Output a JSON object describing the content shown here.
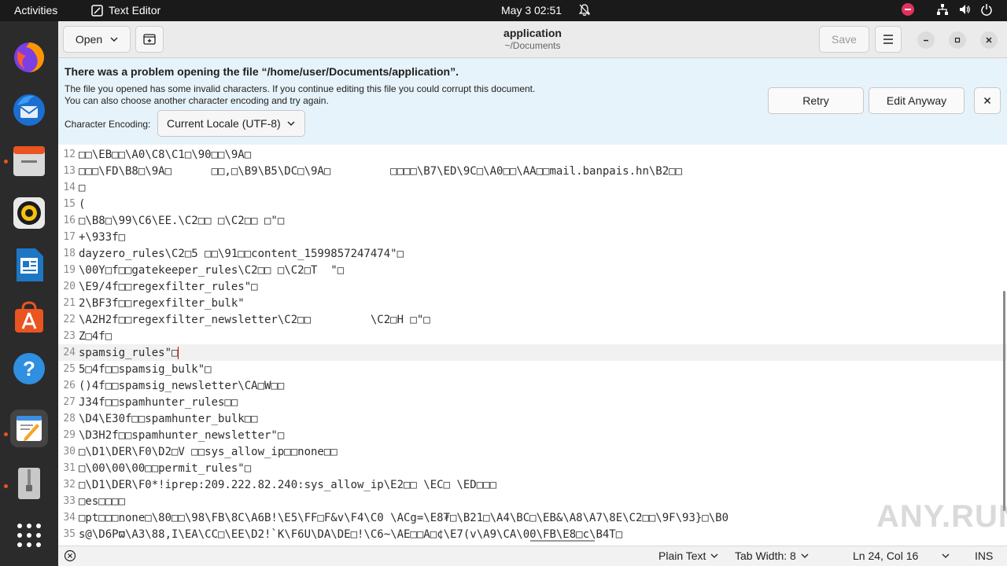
{
  "topbar": {
    "activities": "Activities",
    "app_name": "Text Editor",
    "clock": "May 3  02:51"
  },
  "window": {
    "title": "application",
    "subtitle": "~/Documents",
    "open_label": "Open",
    "save_label": "Save"
  },
  "infobar": {
    "title": "There was a problem opening the file “/home/user/Documents/application”.",
    "line1": "The file you opened has some invalid characters. If you continue editing this file you could corrupt this document.",
    "line2": "You can also choose another character encoding and try again.",
    "encoding_label": "Character Encoding:",
    "encoding_value": "Current Locale (UTF-8)",
    "retry_label": "Retry",
    "edit_anyway_label": "Edit Anyway"
  },
  "editor": {
    "lines": [
      {
        "n": "12",
        "t": "□□\\EB□□\\A0\\C8\\C1□\\90□□\\9A□"
      },
      {
        "n": "13",
        "t": "□□□\\FD\\B8□\\9A□      □□,□\\B9\\B5\\DC□\\9A□         □□□□\\B7\\ED\\9C□\\A0□□\\AA□□mail.banpais.hn\\B2□□"
      },
      {
        "n": "14",
        "t": "□"
      },
      {
        "n": "15",
        "t": "("
      },
      {
        "n": "16",
        "t": "□\\B8□\\99\\C6\\EE.\\C2□□ □\\C2□□ □\"□"
      },
      {
        "n": "17",
        "t": "+\\933f□"
      },
      {
        "n": "18",
        "t": "dayzero_rules\\C2□5 □□\\91□□content_1599857247474\"□"
      },
      {
        "n": "19",
        "t": "\\00Y□f□□gatekeeper_rules\\C2□□ □\\C2□T  \"□"
      },
      {
        "n": "20",
        "t": "\\E9/4f□□regexfilter_rules\"□"
      },
      {
        "n": "21",
        "t": "2\\BF3f□□regexfilter_bulk\""
      },
      {
        "n": "22",
        "t": "\\A2H2f□□regexfilter_newsletter\\C2□□         \\C2□H □\"□"
      },
      {
        "n": "23",
        "t": "Z□4f□"
      },
      {
        "n": "24",
        "t": "spamsig_rules\"□",
        "current": true
      },
      {
        "n": "25",
        "t": "5□4f□□spamsig_bulk\"□"
      },
      {
        "n": "26",
        "t": "()4f□□spamsig_newsletter\\CA□W□□"
      },
      {
        "n": "27",
        "t": "J34f□□spamhunter_rules□□"
      },
      {
        "n": "28",
        "t": "\\D4\\E30f□□spamhunter_bulk□□"
      },
      {
        "n": "29",
        "t": "\\D3H2f□□spamhunter_newsletter\"□"
      },
      {
        "n": "30",
        "t": "□\\D1\\DER\\F0\\D2□V □□sys_allow_ip□□none□□"
      },
      {
        "n": "31",
        "t": "□\\00\\00\\00□□permit_rules\"□"
      },
      {
        "n": "32",
        "t": "□\\D1\\DER\\F0*!iprep:209.222.82.240:sys_allow_ip\\E2□□ \\EC□ \\ED□□□"
      },
      {
        "n": "33",
        "t": "□es□□□□"
      },
      {
        "n": "34",
        "t": "□pt□□□none□\\80□□\\98\\FB\\8C\\A6B!\\E5\\FF□F&v\\F4\\C0 \\ACg=\\E8₮□\\B21□\\A4\\BC□\\EB&\\A8\\A7\\8E\\C2□□\\9F\\93}□\\B0"
      },
      {
        "n": "35",
        "t": "s@\\D6Pϖ\\A3\\88,I\\EA\\CC□\\EE\\D2!`K\\F6U\\DA\\DE□!\\C6~\\AE□□A□¢\\E7(v\\A9\\CA\\00\\FB\\E8□c\\B4T□"
      }
    ]
  },
  "statusbar": {
    "language": "Plain Text",
    "tab_width": "Tab Width: 8",
    "position": "Ln 24, Col 16",
    "mode": "INS"
  },
  "watermark": "ANY.RUN"
}
